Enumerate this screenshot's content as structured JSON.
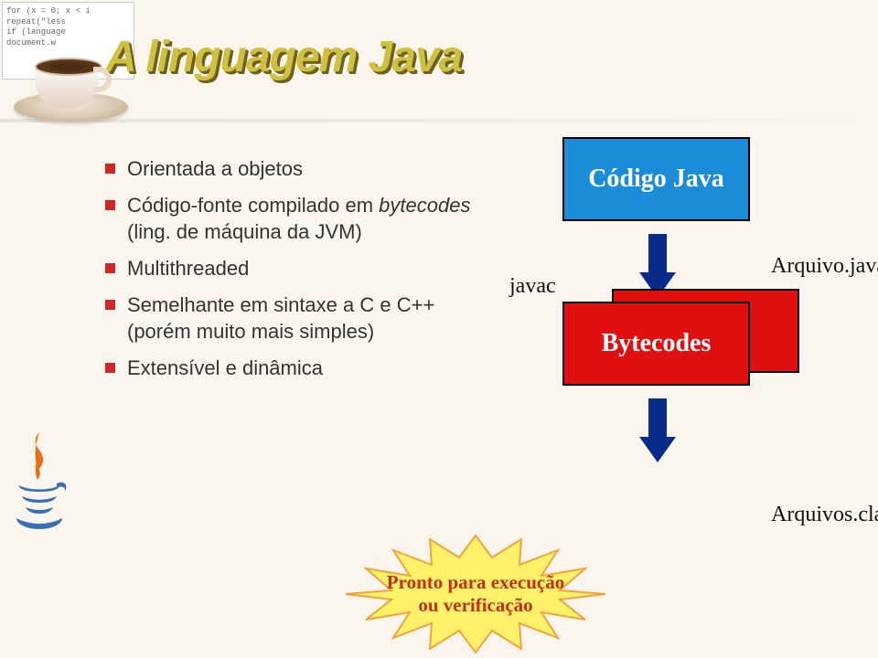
{
  "title": "A linguagem Java",
  "code_snippet": "for (x = 0; x < i\nrepeat(\"less\nif (language\ndocument.w",
  "bullets": [
    {
      "text": "Orientada a objetos"
    },
    {
      "text": "Código-fonte compilado em ",
      "italic_tail": "bytecodes",
      "tail2": " (ling. de máquina da JVM)"
    },
    {
      "text": "Multithreaded"
    },
    {
      "text": "Semelhante em sintaxe a C e C++ (porém muito mais simples)"
    },
    {
      "text": "Extensível e dinâmica"
    }
  ],
  "diagram": {
    "box_top": "Código Java",
    "box_bottom": "Bytecodes",
    "label_javac": "javac",
    "label_arquivo_java": "Arquivo.java",
    "label_arquivos_class": "Arquivos.class"
  },
  "starburst": {
    "line1": "Pronto para execução",
    "line2": "ou verificação"
  }
}
